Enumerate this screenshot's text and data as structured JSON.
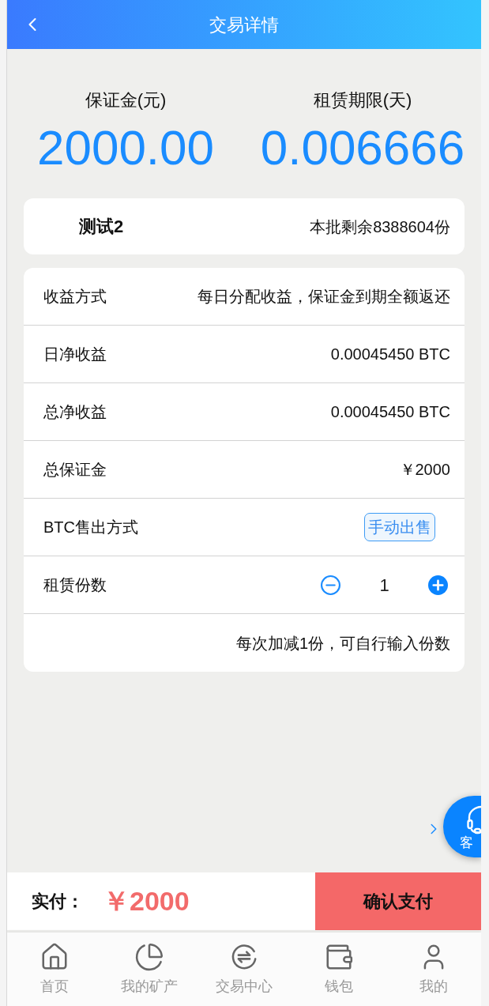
{
  "header": {
    "title": "交易详情"
  },
  "summary": [
    {
      "label": "保证金(元)",
      "value": "2000.00"
    },
    {
      "label": "租赁期限(天)",
      "value": "0.006666"
    }
  ],
  "product": {
    "name": "测试2",
    "remaining": "本批剩余8388604份"
  },
  "details": [
    {
      "kind": "text",
      "label": "收益方式",
      "value": "每日分配收益，保证金到期全额返还"
    },
    {
      "kind": "text",
      "label": "日净收益",
      "value": "0.00045450 BTC"
    },
    {
      "kind": "text",
      "label": "总净收益",
      "value": "0.00045450 BTC"
    },
    {
      "kind": "text",
      "label": "总保证金",
      "value": "￥2000"
    },
    {
      "kind": "button",
      "label": "BTC售出方式",
      "value": "手动出售"
    },
    {
      "kind": "stepper",
      "label": "租赁份数",
      "value": "1"
    },
    {
      "kind": "note",
      "value": "每次加减1份，可自行输入份数"
    }
  ],
  "service": {
    "label": "客"
  },
  "checkout": {
    "label": "实付：",
    "amount": "￥2000",
    "button": "确认支付"
  },
  "nav": [
    {
      "kind": "home",
      "label": "首页"
    },
    {
      "kind": "pie",
      "label": "我的矿产"
    },
    {
      "kind": "exchange",
      "label": "交易中心"
    },
    {
      "kind": "wallet",
      "label": "钱包"
    },
    {
      "kind": "user",
      "label": "我的"
    }
  ]
}
